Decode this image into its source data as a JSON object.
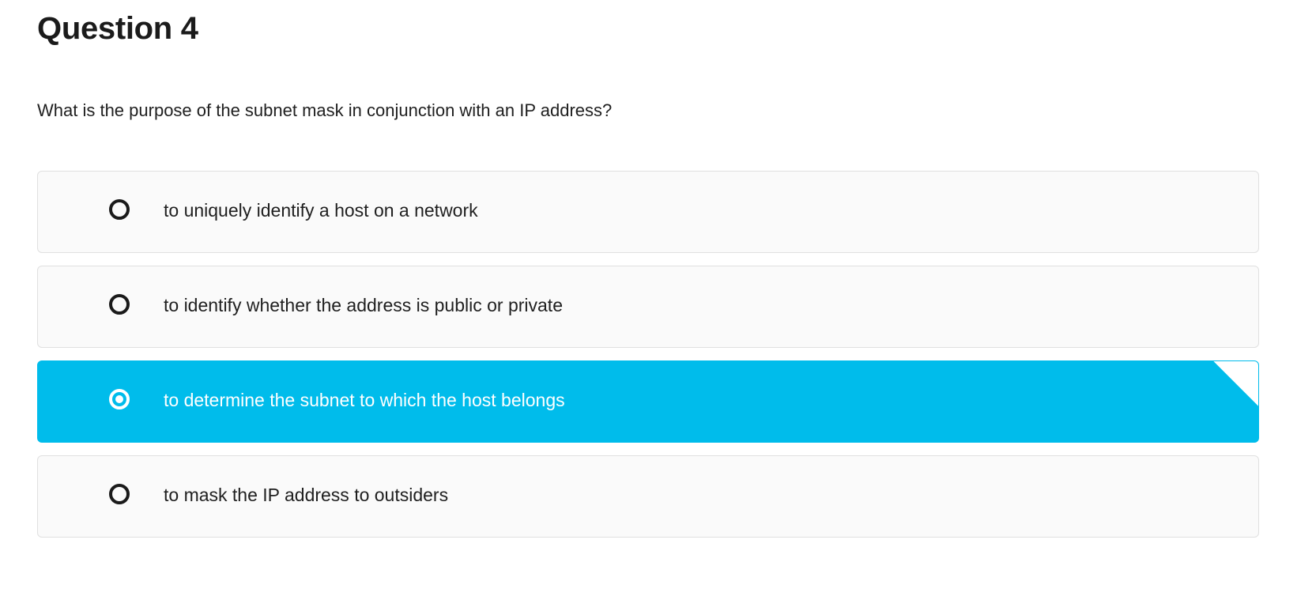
{
  "question": {
    "title": "Question 4",
    "text": "What is the purpose of the subnet mask in conjunction with an IP address?"
  },
  "options": [
    {
      "label": "to uniquely identify a host on a network",
      "selected": false
    },
    {
      "label": "to identify whether the address is public or private",
      "selected": false
    },
    {
      "label": "to determine the subnet to which the host belongs",
      "selected": true
    },
    {
      "label": "to mask the IP address to outsiders",
      "selected": false
    }
  ],
  "colors": {
    "selected_background": "#00bceb",
    "option_background": "#fafafa",
    "option_border": "#e0e0e0",
    "text": "#1f1f1f"
  },
  "icons": {
    "radio_unselected": "radio-unselected-icon",
    "radio_selected": "radio-selected-icon",
    "selected_corner": "corner-fold-icon"
  }
}
